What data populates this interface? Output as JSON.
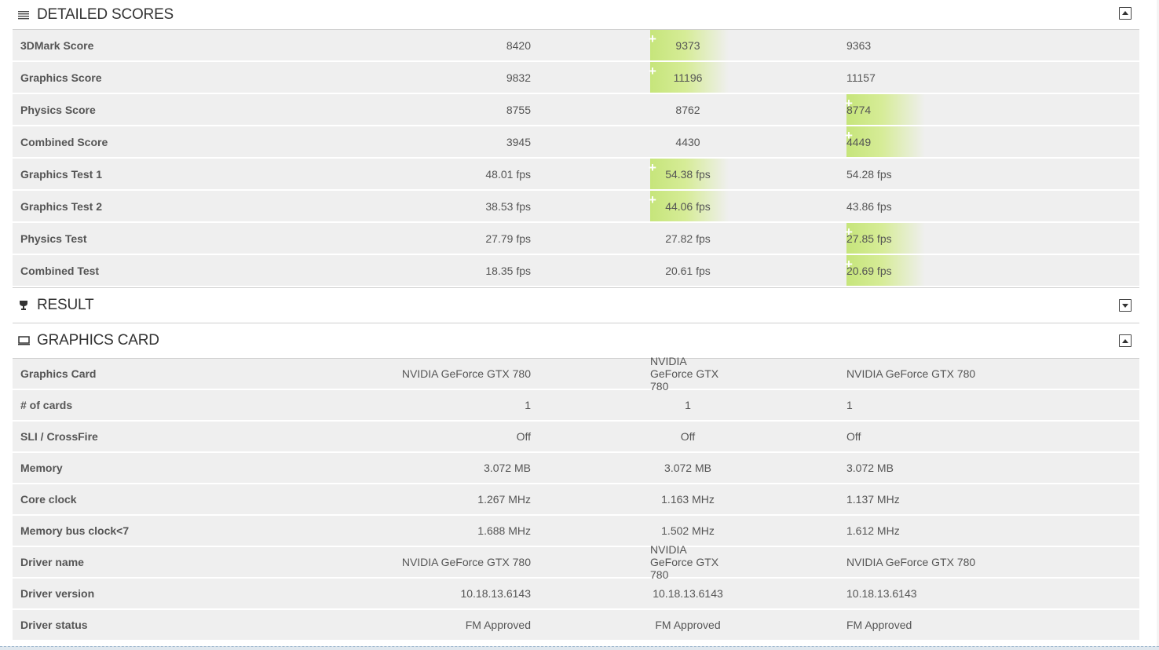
{
  "detailed_scores": {
    "title": "DETAILED SCORES",
    "rows": [
      {
        "label": "3DMark Score",
        "v1": "8420",
        "v2": "9373",
        "v3": "9363",
        "best": 2
      },
      {
        "label": "Graphics Score",
        "v1": "9832",
        "v2": "11196",
        "v3": "11157",
        "best": 2
      },
      {
        "label": "Physics Score",
        "v1": "8755",
        "v2": "8762",
        "v3": "8774",
        "best": 3
      },
      {
        "label": "Combined Score",
        "v1": "3945",
        "v2": "4430",
        "v3": "4449",
        "best": 3
      },
      {
        "label": "Graphics Test 1",
        "v1": "48.01 fps",
        "v2": "54.38 fps",
        "v3": "54.28 fps",
        "best": 2
      },
      {
        "label": "Graphics Test 2",
        "v1": "38.53 fps",
        "v2": "44.06 fps",
        "v3": "43.86 fps",
        "best": 2
      },
      {
        "label": "Physics Test",
        "v1": "27.79 fps",
        "v2": "27.82 fps",
        "v3": "27.85 fps",
        "best": 3
      },
      {
        "label": "Combined Test",
        "v1": "18.35 fps",
        "v2": "20.61 fps",
        "v3": "20.69 fps",
        "best": 3
      }
    ]
  },
  "result": {
    "title": "RESULT"
  },
  "graphics_card": {
    "title": "GRAPHICS CARD",
    "rows": [
      {
        "label": "Graphics Card",
        "v1": "NVIDIA GeForce GTX 780",
        "v2": "NVIDIA GeForce GTX 780",
        "v3": "NVIDIA GeForce GTX 780"
      },
      {
        "label": "# of cards",
        "v1": "1",
        "v2": "1",
        "v3": "1"
      },
      {
        "label": "SLI / CrossFire",
        "v1": "Off",
        "v2": "Off",
        "v3": "Off"
      },
      {
        "label": "Memory",
        "v1": "3.072 MB",
        "v2": "3.072 MB",
        "v3": "3.072 MB"
      },
      {
        "label": "Core clock",
        "v1": "1.267 MHz",
        "v2": "1.163 MHz",
        "v3": "1.137 MHz"
      },
      {
        "label": "Memory bus clock<7",
        "v1": "1.688 MHz",
        "v2": "1.502 MHz",
        "v3": "1.612 MHz"
      },
      {
        "label": "Driver name",
        "v1": "NVIDIA GeForce GTX 780",
        "v2": "NVIDIA GeForce GTX 780",
        "v3": "NVIDIA GeForce GTX 780"
      },
      {
        "label": "Driver version",
        "v1": "10.18.13.6143",
        "v2": "10.18.13.6143",
        "v3": "10.18.13.6143"
      },
      {
        "label": "Driver status",
        "v1": "FM Approved",
        "v2": "FM Approved",
        "v3": "FM Approved"
      }
    ]
  },
  "icons": {
    "detailed_scores": "list-icon",
    "result": "trophy-icon",
    "graphics_card": "monitor-icon",
    "collapse": "collapse-up-icon",
    "expand": "expand-down-icon",
    "best_marker": "plus-icon"
  },
  "colors": {
    "best_highlight": "#c6e57b",
    "row_bg": "#efefef",
    "header_text": "#333333"
  }
}
